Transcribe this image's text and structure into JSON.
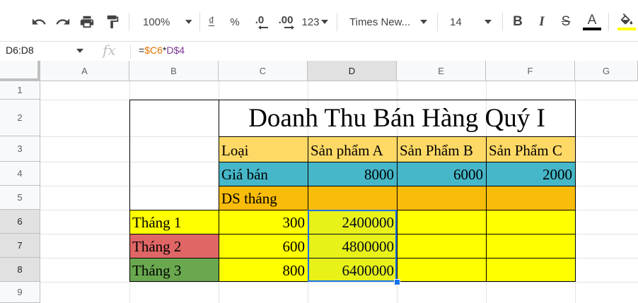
{
  "toolbar": {
    "zoom": "100%",
    "currency": "₫",
    "percent": "%",
    "dec_decrease": ".0",
    "dec_increase": ".00",
    "more_formats": "123",
    "font_family": "Times New...",
    "font_size": "14",
    "bold": "B",
    "italic": "I",
    "strike": "S",
    "text_color_letter": "A",
    "text_color": "#000000",
    "fill_color": "#ffff00"
  },
  "formula_bar": {
    "name_box": "D6:D8",
    "fx": "fx",
    "formula_prefix": "=",
    "formula_ref1": "$C6",
    "formula_op": "*",
    "formula_ref2": "D$4",
    "ref1_color": "#e37400",
    "ref2_color": "#7e3794"
  },
  "columns": [
    "A",
    "B",
    "C",
    "D",
    "E",
    "F",
    "G"
  ],
  "rows": [
    "1",
    "2",
    "3",
    "4",
    "5",
    "6",
    "7",
    "8",
    "9"
  ],
  "selected_column": "D",
  "selected_rows": [
    "6",
    "7",
    "8"
  ],
  "sheet": {
    "title": "Doanh Thu Bán Hàng Quý I",
    "header_row": [
      "Loại",
      "Sản phẩm A",
      "Sản Phẩm B",
      "Sản Phẩm C"
    ],
    "price_label": "Giá bán",
    "prices": [
      "8000",
      "6000",
      "2000"
    ],
    "sales_label": "DS tháng",
    "months": [
      {
        "name": "Tháng 1",
        "qty": "300",
        "revenue_a": "2400000"
      },
      {
        "name": "Tháng 2",
        "qty": "600",
        "revenue_a": "4800000"
      },
      {
        "name": "Tháng 3",
        "qty": "800",
        "revenue_a": "6400000"
      }
    ]
  },
  "colors": {
    "header_fill": "#ffd966",
    "price_fill": "#45b7c8",
    "sales_fill": "#f9bc0a",
    "yellow": "#ffff00",
    "month2": "#e06666",
    "month3": "#6aa84f",
    "selection": "#1a73e8"
  }
}
